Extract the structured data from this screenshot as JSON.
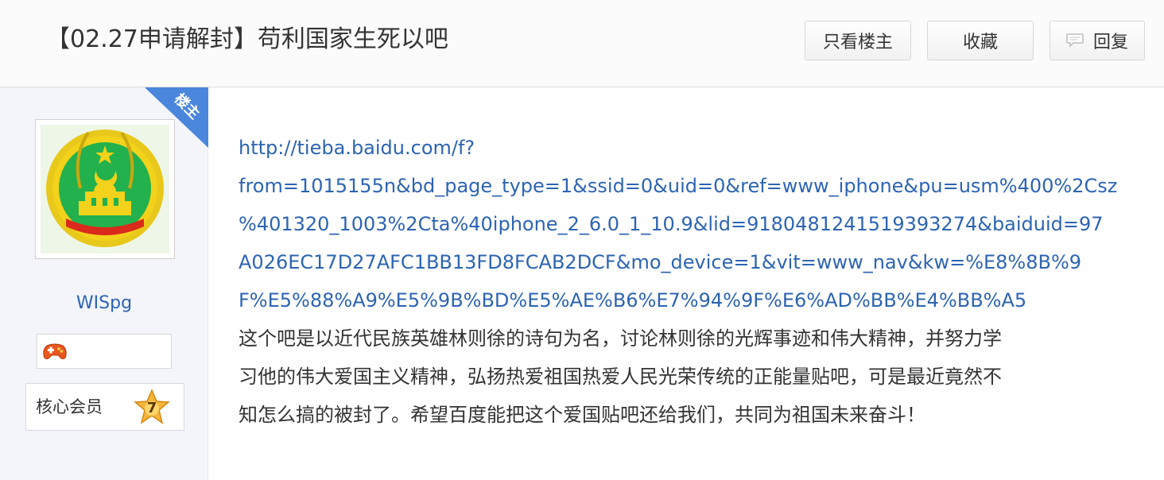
{
  "post": {
    "title": "【02.27申请解封】苟利国家生死以吧",
    "author_badge": "楼主",
    "link_lines": [
      "http://tieba.baidu.com/f?",
      "from=1015155n&bd_page_type=1&ssid=0&uid=0&ref=www_iphone&pu=usm%400%2Csz",
      "%401320_1003%2Cta%40iphone_2_6.0_1_10.9&lid=9180481241519393274&baiduid=97",
      "A026EC17D27AFC1BB13FD8FCAB2DCF&mo_device=1&vit=www_nav&kw=%E8%8B%9",
      "F%E5%88%A9%E5%9B%BD%E5%AE%B6%E7%94%9F%E6%AD%BB%E4%BB%A5"
    ],
    "body_lines": [
      "这个吧是以近代民族英雄林则徐的诗句为名，讨论林则徐的光辉事迹和伟大精神，并努力学",
      "习他的伟大爱国主义精神，弘扬热爱祖国热爱人民光荣传统的正能量贴吧，可是最近竟然不",
      "知怎么搞的被封了。希望百度能把这个爱国贴吧还给我们，共同为祖国未来奋斗！"
    ]
  },
  "toolbar": {
    "only_op_label": "只看楼主",
    "favorite_label": "收藏",
    "reply_label": "回复"
  },
  "author": {
    "username": "WISpg",
    "member_label": "核心会员",
    "level": "7"
  },
  "colors": {
    "link": "#2d64b3",
    "corner_badge": "#4a86dc",
    "sidebar_bg": "#f3f5fb",
    "avatar_green": "#22b14c",
    "avatar_gold": "#f2d21b"
  },
  "icons": {
    "reply": "speech-bubble-icon",
    "avatar": "emblem-avatar",
    "game": "gamepad-icon",
    "level": "star-badge-icon"
  }
}
